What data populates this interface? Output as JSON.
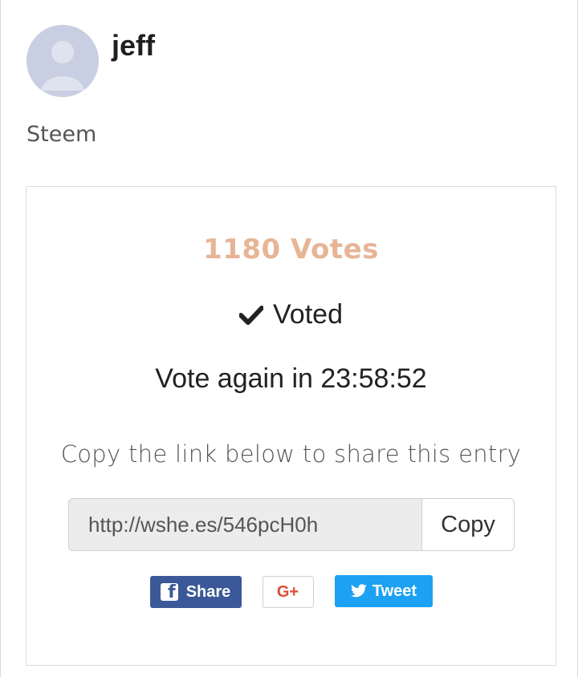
{
  "profile": {
    "username": "jeff",
    "avatar_icon": "user-avatar-placeholder",
    "category": "Steem"
  },
  "entry": {
    "votes_label": "1180 Votes",
    "voted_label": "Voted",
    "vote_again_label": "Vote again in 23:58:52",
    "share_prompt": "Copy the link below to share this entry",
    "share_link": "http://wshe.es/546pcH0h",
    "copy_label": "Copy"
  },
  "social": {
    "facebook_label": "Share",
    "facebook_icon": "facebook-icon",
    "gplus_label": "G+",
    "twitter_label": "Tweet",
    "twitter_icon": "twitter-bird-icon"
  },
  "colors": {
    "votes_accent": "#e7b596",
    "facebook": "#3b5998",
    "gplus": "#dd4b39",
    "twitter": "#1da1f2"
  }
}
